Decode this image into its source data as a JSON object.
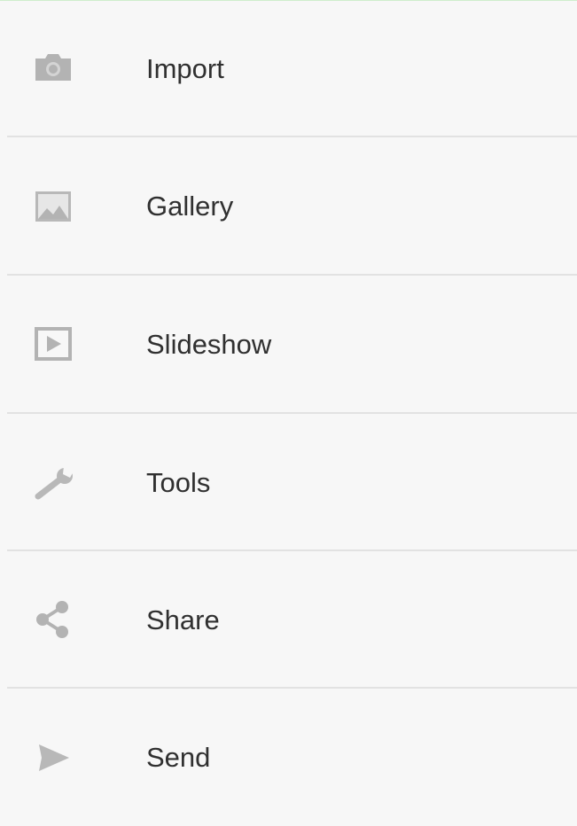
{
  "menu": {
    "items": [
      {
        "label": "Import",
        "icon": "camera-icon"
      },
      {
        "label": "Gallery",
        "icon": "image-icon"
      },
      {
        "label": "Slideshow",
        "icon": "slideshow-icon"
      },
      {
        "label": "Tools",
        "icon": "wrench-icon"
      },
      {
        "label": "Share",
        "icon": "share-icon"
      },
      {
        "label": "Send",
        "icon": "send-icon"
      }
    ]
  },
  "colors": {
    "background": "#f7f7f7",
    "text": "#303030",
    "icon": "#b3b3b3",
    "divider": "#e2e2e2",
    "top_accent": "#cfeecd"
  }
}
